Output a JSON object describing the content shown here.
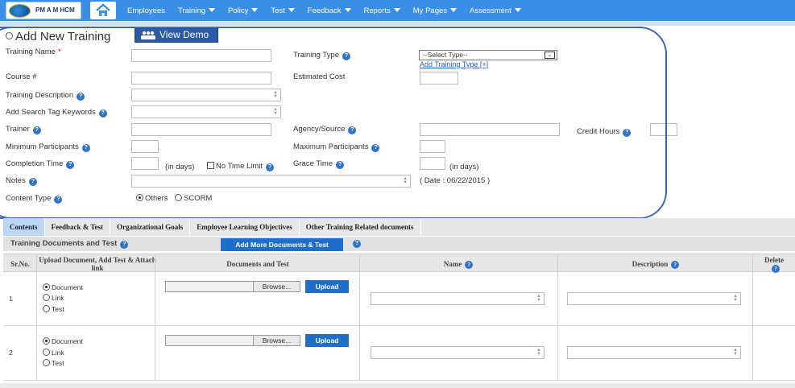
{
  "brand": {
    "logo_text": "PM A M HCM"
  },
  "nav": [
    "Employees",
    "Training",
    "Policy",
    "Test",
    "Feedback",
    "Reports",
    "My Pages",
    "Assessment"
  ],
  "page": {
    "title": "Add New Training",
    "demo_button": "View Demo"
  },
  "form": {
    "training_name": "Training Name",
    "training_type": "Training Type",
    "training_type_value": "--Select Type--",
    "add_training_type": "Add Training Type [+]",
    "course_no": "Course #",
    "estimated_cost": "Estimated Cost",
    "training_description": "Training Description",
    "search_tags": "Add Search Tag Keywords",
    "trainer": "Trainer",
    "agency": "Agency/Source",
    "credit_hours": "Credit Hours",
    "min_participants": "Minimum Participants",
    "max_participants": "Maximum Participants",
    "completion_time": "Completion Time",
    "in_days": "(in days)",
    "no_time_limit": "No Time Limit",
    "grace_time": "Grace Time",
    "grace_in_days": "(in days)",
    "notes": "Notes",
    "date_note": "( Date : 06/22/2015 )",
    "content_type": "Content Type",
    "content_opt_others": "Others",
    "content_opt_scorm": "SCORM"
  },
  "tabs": [
    "Contents",
    "Feedback & Test",
    "Organizational Goals",
    "Employee Learning Objectives",
    "Other Training Related documents"
  ],
  "docs": {
    "section_title": "Training Documents and Test",
    "add_more": "Add More Documents & Test",
    "headers": {
      "srno": "Sr.No.",
      "upload": "Upload Document, Add Test & Attach link",
      "documents": "Documents and Test",
      "name": "Name",
      "description": "Description",
      "delete": "Delete"
    },
    "rows": [
      {
        "sr": "1",
        "opt1": "Document",
        "opt2": "Link",
        "opt3": "Test",
        "browse": "Browse...",
        "upload": "Upload"
      },
      {
        "sr": "2",
        "opt1": "Document",
        "opt2": "Link",
        "opt3": "Test",
        "browse": "Browse...",
        "upload": "Upload"
      }
    ]
  }
}
